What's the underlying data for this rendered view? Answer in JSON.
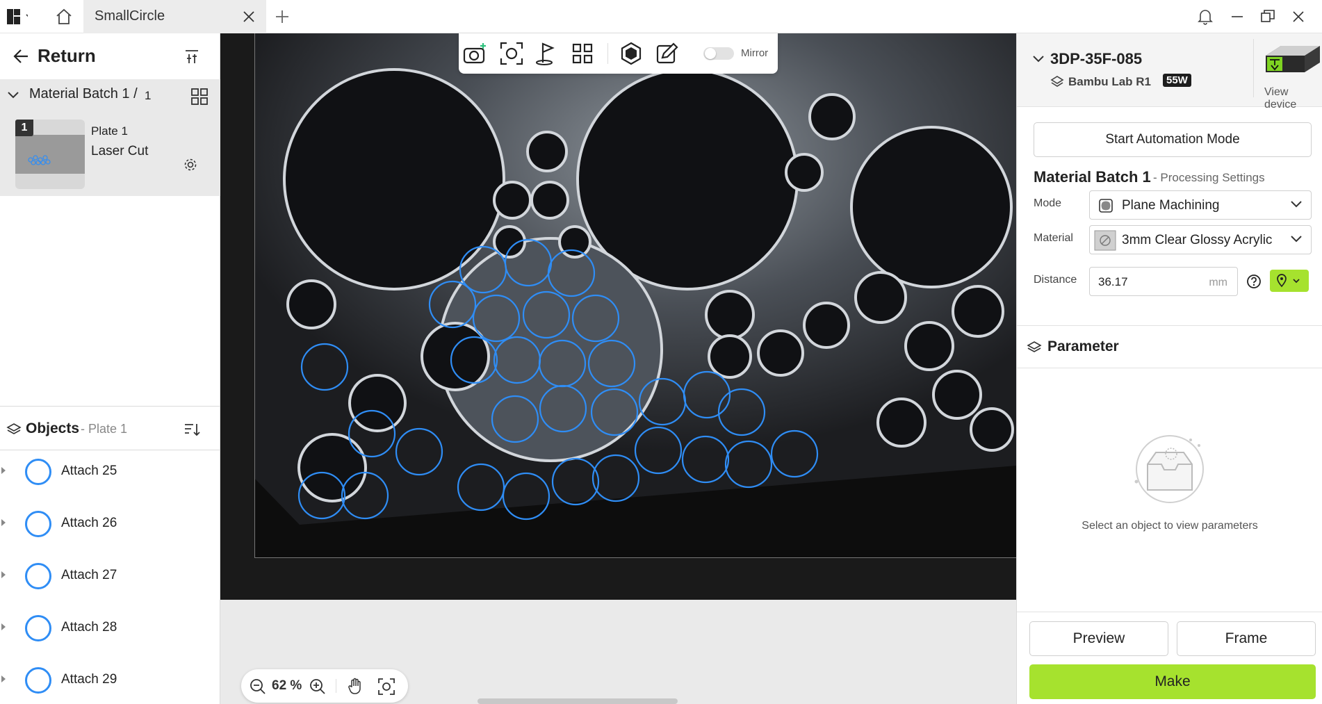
{
  "app": {
    "tab_title": "SmallCircle"
  },
  "left_panel": {
    "return_label": "Return",
    "batch": {
      "name": "Material Batch 1 /",
      "count": "1",
      "plate": {
        "index": "1",
        "name": "Plate 1",
        "type": "Laser Cut"
      }
    },
    "objects": {
      "title": "Objects",
      "subtitle": "- Plate 1",
      "items": [
        {
          "label": "Attach 25"
        },
        {
          "label": "Attach 26"
        },
        {
          "label": "Attach 27"
        },
        {
          "label": "Attach 28"
        },
        {
          "label": "Attach 29"
        }
      ]
    }
  },
  "canvas": {
    "toolbar": {
      "icons": [
        "camera-add-icon",
        "focus-scan-icon",
        "golf-flag-icon",
        "grid-icon",
        "hexagon-icon",
        "edit-image-icon"
      ],
      "mirror_label": "Mirror",
      "mirror_on": false
    },
    "zoom": {
      "value": "62 %"
    }
  },
  "right_panel": {
    "device": {
      "name": "3DP-35F-085",
      "model": "Bambu Lab R1",
      "power": "55W",
      "view_label": "View device"
    },
    "automation_label": "Start Automation Mode",
    "batch_title": "Material Batch 1",
    "batch_subtitle": "- Processing Settings",
    "mode_label": "Mode",
    "mode_value": "Plane Machining",
    "material_label": "Material",
    "material_value": "3mm Clear Glossy Acrylic",
    "distance_label": "Distance",
    "distance_value": "36.17",
    "distance_unit": "mm",
    "parameter_title": "Parameter",
    "empty_hint": "Select an object to view parameters",
    "preview_label": "Preview",
    "frame_label": "Frame",
    "make_label": "Make"
  },
  "colors": {
    "accent_green": "#a6e22e",
    "selection_blue": "#2f8df5"
  }
}
